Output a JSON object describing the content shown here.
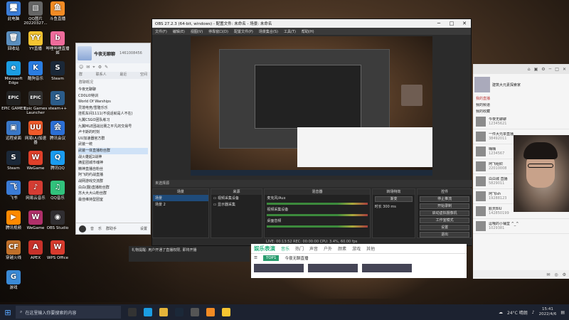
{
  "desktop": {
    "icons": [
      {
        "label": "此电脑",
        "glyph": "🖥",
        "color": "#3b7dd8"
      },
      {
        "label": "QQ图片20220327...",
        "glyph": "▧",
        "color": "#666"
      },
      {
        "label": "斗鱼直播",
        "glyph": "鱼",
        "color": "#f28b24"
      },
      {
        "label": "回收站",
        "glyph": "🗑",
        "color": "#5b8fbf"
      },
      {
        "label": "YY直播",
        "glyph": "YY",
        "color": "#f6c531"
      },
      {
        "label": "哔哩哔哩直播姬",
        "glyph": "b",
        "color": "#ef6c9c"
      },
      {
        "label": "Microsoft Edge",
        "glyph": "e",
        "color": "#1b9de2"
      },
      {
        "label": "酷狗音乐",
        "glyph": "K",
        "color": "#2a7de1"
      },
      {
        "label": "Steam",
        "glyph": "S",
        "color": "#1b2838"
      },
      {
        "label": "EPIC GAMES",
        "glyph": "EPIC",
        "color": "#222"
      },
      {
        "label": "Epic Games Launcher",
        "glyph": "EPIC",
        "color": "#333"
      },
      {
        "label": "steam++",
        "glyph": "S",
        "color": "#2b5c8a"
      },
      {
        "label": "远程桌面",
        "glyph": "▣",
        "color": "#3a78c8"
      },
      {
        "label": "网易UU加速器",
        "glyph": "UU",
        "color": "#f05a2a"
      },
      {
        "label": "腾讯会议",
        "glyph": "会",
        "color": "#2b6fd6"
      },
      {
        "label": "Steam",
        "glyph": "S",
        "color": "#1b2838"
      },
      {
        "label": "WeGame",
        "glyph": "W",
        "color": "#e0402a"
      },
      {
        "label": "腾讯QQ",
        "glyph": "Q",
        "color": "#1a9cf0"
      },
      {
        "label": "飞书",
        "glyph": "飞",
        "color": "#3a7bd5"
      },
      {
        "label": "网易云音乐",
        "glyph": "♪",
        "color": "#d43c33"
      },
      {
        "label": "QQ音乐",
        "glyph": "♫",
        "color": "#31c27c"
      },
      {
        "label": "腾讯视频",
        "glyph": "▶",
        "color": "#ff8a00"
      },
      {
        "label": "WeGame",
        "glyph": "W",
        "color": "#b0306a"
      },
      {
        "label": "OBS Studio",
        "glyph": "◉",
        "color": "#302e31"
      },
      {
        "label": "穿越火线",
        "glyph": "CF",
        "color": "#c0702a"
      },
      {
        "label": "APEX",
        "glyph": "A",
        "color": "#c8322a"
      },
      {
        "label": "WPS Office",
        "glyph": "W",
        "color": "#d83b2e"
      },
      {
        "label": "游戏",
        "glyph": "G",
        "color": "#3a8ad6"
      }
    ]
  },
  "qq": {
    "nickname": "今夜无聊聊",
    "qq_number": "1461008456",
    "tabs": [
      "群",
      "联系人",
      "最近",
      "空间"
    ],
    "section": "群聊概况",
    "groups": [
      "今夜无聊聊",
      "CD0LI0特训",
      "World Of Warships",
      "灵境电竞/雪隆乐乐",
      "挂机车间1111(不说话就是人不在)",
      "九翼CSGO团队练习",
      "九翼MLE团战比赛之平凡的交易号",
      "卢卡斯的时刻",
      "UU加速器官方群",
      "武装一统",
      "武装一体直播粉丝群",
      "战火雄起2战神",
      "摘星团城市魂神",
      "精神直播自粉丝",
      "阿飞的约战直播",
      "战网游戏交流群",
      "白白(翻)直播粉丝群",
      "苏大大大山粉丝群",
      "最佳维持型团室"
    ],
    "footer": [
      "音",
      "乐",
      "群助手",
      "设置"
    ]
  },
  "obs": {
    "title": "OBS 27.2.3 (64-bit, windows) - 配置文件: 未命名 - 场景: 未命名",
    "menu": [
      "文件(F)",
      "编辑(E)",
      "视图(V)",
      "停靠窗口(D)",
      "配置文件(P)",
      "场景集合(S)",
      "工具(T)",
      "帮助(H)"
    ],
    "source_bar": "未选择源",
    "docks": {
      "scenes": {
        "title": "场景",
        "items": [
          "场景",
          "场景 2"
        ]
      },
      "sources": {
        "title": "来源",
        "items": [
          "视频采集设备",
          "显示器采集"
        ]
      },
      "mixer": {
        "title": "混音器",
        "channels": [
          {
            "name": "麦克风/Aux",
            "db": "0.0 dB"
          },
          {
            "name": "视频采集设备",
            "db": "0.0 dB"
          },
          {
            "name": "桌面音频",
            "db": "0.0 dB"
          }
        ]
      },
      "transitions": {
        "title": "转场特效",
        "type": "渐变",
        "duration_label": "时长",
        "duration": "300 ms"
      },
      "controls": {
        "title": "控件",
        "buttons": [
          "停止推流",
          "开始录制",
          "启动虚拟摄像机",
          "工作室模式",
          "设置",
          "退出"
        ]
      }
    },
    "status": "LIVE: 00:13:52   REC: 00:00:00   CPU: 3.4%, 60.00 fps"
  },
  "right_panel": {
    "header_icons": [
      "⌂",
      "▣",
      "⚙",
      "─",
      "□",
      "✕"
    ],
    "user_line": "建筑大元素探索家",
    "section_label": "我的直播",
    "rows": [
      {
        "name": "我的频道",
        "sub": ""
      },
      {
        "name": "我的收藏",
        "sub": ""
      },
      {
        "name": "今夜无聊聊",
        "sub": "12345621"
      },
      {
        "name": "一件大元单直播",
        "sub": "38492011"
      },
      {
        "name": "嗨嗨",
        "sub": "1234567"
      },
      {
        "name": "阿飞组织",
        "sub": "22010008"
      },
      {
        "name": "白白城 直播",
        "sub": "5829011"
      },
      {
        "name": "阿飞lsh",
        "sub": "19288123"
      },
      {
        "name": "颜天BIU",
        "sub": "142850199"
      },
      {
        "name": "逗哦的小铺堂 ^_^",
        "sub": "1029381"
      }
    ],
    "footer_icons": [
      "✉",
      "◎",
      "⚙"
    ]
  },
  "music": {
    "logo": "娱乐表演",
    "tabs": [
      "音乐",
      "热门",
      "声音",
      "户外",
      "颜素",
      "游戏",
      "其他"
    ],
    "chip": "TOP1",
    "sub": "今夜无聊直播"
  },
  "notice": {
    "text": "礼物提醒: 用户开通了直播权限, 即将开播"
  },
  "taskbar": {
    "search_placeholder": "在这里输入你要搜索的内容",
    "weather": "24°C 晴朗",
    "time": "15:41",
    "date": "2022/4/6"
  },
  "colors": {
    "taskbar": "#1c2230",
    "obs_bg": "#2b2b2b",
    "accent": "#22b07a"
  }
}
